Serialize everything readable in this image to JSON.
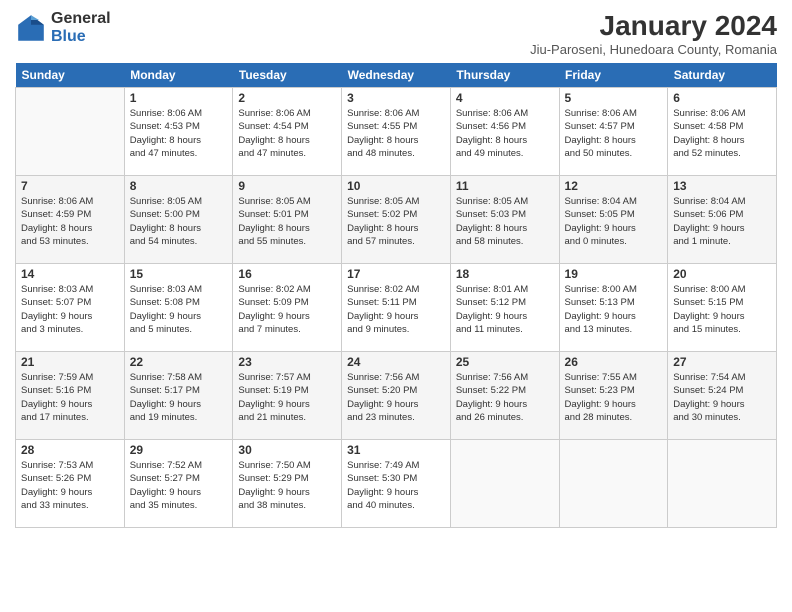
{
  "logo": {
    "general": "General",
    "blue": "Blue"
  },
  "title": "January 2024",
  "subtitle": "Jiu-Paroseni, Hunedoara County, Romania",
  "days_header": [
    "Sunday",
    "Monday",
    "Tuesday",
    "Wednesday",
    "Thursday",
    "Friday",
    "Saturday"
  ],
  "weeks": [
    [
      {
        "num": "",
        "info": ""
      },
      {
        "num": "1",
        "info": "Sunrise: 8:06 AM\nSunset: 4:53 PM\nDaylight: 8 hours\nand 47 minutes."
      },
      {
        "num": "2",
        "info": "Sunrise: 8:06 AM\nSunset: 4:54 PM\nDaylight: 8 hours\nand 47 minutes."
      },
      {
        "num": "3",
        "info": "Sunrise: 8:06 AM\nSunset: 4:55 PM\nDaylight: 8 hours\nand 48 minutes."
      },
      {
        "num": "4",
        "info": "Sunrise: 8:06 AM\nSunset: 4:56 PM\nDaylight: 8 hours\nand 49 minutes."
      },
      {
        "num": "5",
        "info": "Sunrise: 8:06 AM\nSunset: 4:57 PM\nDaylight: 8 hours\nand 50 minutes."
      },
      {
        "num": "6",
        "info": "Sunrise: 8:06 AM\nSunset: 4:58 PM\nDaylight: 8 hours\nand 52 minutes."
      }
    ],
    [
      {
        "num": "7",
        "info": "Sunrise: 8:06 AM\nSunset: 4:59 PM\nDaylight: 8 hours\nand 53 minutes."
      },
      {
        "num": "8",
        "info": "Sunrise: 8:05 AM\nSunset: 5:00 PM\nDaylight: 8 hours\nand 54 minutes."
      },
      {
        "num": "9",
        "info": "Sunrise: 8:05 AM\nSunset: 5:01 PM\nDaylight: 8 hours\nand 55 minutes."
      },
      {
        "num": "10",
        "info": "Sunrise: 8:05 AM\nSunset: 5:02 PM\nDaylight: 8 hours\nand 57 minutes."
      },
      {
        "num": "11",
        "info": "Sunrise: 8:05 AM\nSunset: 5:03 PM\nDaylight: 8 hours\nand 58 minutes."
      },
      {
        "num": "12",
        "info": "Sunrise: 8:04 AM\nSunset: 5:05 PM\nDaylight: 9 hours\nand 0 minutes."
      },
      {
        "num": "13",
        "info": "Sunrise: 8:04 AM\nSunset: 5:06 PM\nDaylight: 9 hours\nand 1 minute."
      }
    ],
    [
      {
        "num": "14",
        "info": "Sunrise: 8:03 AM\nSunset: 5:07 PM\nDaylight: 9 hours\nand 3 minutes."
      },
      {
        "num": "15",
        "info": "Sunrise: 8:03 AM\nSunset: 5:08 PM\nDaylight: 9 hours\nand 5 minutes."
      },
      {
        "num": "16",
        "info": "Sunrise: 8:02 AM\nSunset: 5:09 PM\nDaylight: 9 hours\nand 7 minutes."
      },
      {
        "num": "17",
        "info": "Sunrise: 8:02 AM\nSunset: 5:11 PM\nDaylight: 9 hours\nand 9 minutes."
      },
      {
        "num": "18",
        "info": "Sunrise: 8:01 AM\nSunset: 5:12 PM\nDaylight: 9 hours\nand 11 minutes."
      },
      {
        "num": "19",
        "info": "Sunrise: 8:00 AM\nSunset: 5:13 PM\nDaylight: 9 hours\nand 13 minutes."
      },
      {
        "num": "20",
        "info": "Sunrise: 8:00 AM\nSunset: 5:15 PM\nDaylight: 9 hours\nand 15 minutes."
      }
    ],
    [
      {
        "num": "21",
        "info": "Sunrise: 7:59 AM\nSunset: 5:16 PM\nDaylight: 9 hours\nand 17 minutes."
      },
      {
        "num": "22",
        "info": "Sunrise: 7:58 AM\nSunset: 5:17 PM\nDaylight: 9 hours\nand 19 minutes."
      },
      {
        "num": "23",
        "info": "Sunrise: 7:57 AM\nSunset: 5:19 PM\nDaylight: 9 hours\nand 21 minutes."
      },
      {
        "num": "24",
        "info": "Sunrise: 7:56 AM\nSunset: 5:20 PM\nDaylight: 9 hours\nand 23 minutes."
      },
      {
        "num": "25",
        "info": "Sunrise: 7:56 AM\nSunset: 5:22 PM\nDaylight: 9 hours\nand 26 minutes."
      },
      {
        "num": "26",
        "info": "Sunrise: 7:55 AM\nSunset: 5:23 PM\nDaylight: 9 hours\nand 28 minutes."
      },
      {
        "num": "27",
        "info": "Sunrise: 7:54 AM\nSunset: 5:24 PM\nDaylight: 9 hours\nand 30 minutes."
      }
    ],
    [
      {
        "num": "28",
        "info": "Sunrise: 7:53 AM\nSunset: 5:26 PM\nDaylight: 9 hours\nand 33 minutes."
      },
      {
        "num": "29",
        "info": "Sunrise: 7:52 AM\nSunset: 5:27 PM\nDaylight: 9 hours\nand 35 minutes."
      },
      {
        "num": "30",
        "info": "Sunrise: 7:50 AM\nSunset: 5:29 PM\nDaylight: 9 hours\nand 38 minutes."
      },
      {
        "num": "31",
        "info": "Sunrise: 7:49 AM\nSunset: 5:30 PM\nDaylight: 9 hours\nand 40 minutes."
      },
      {
        "num": "",
        "info": ""
      },
      {
        "num": "",
        "info": ""
      },
      {
        "num": "",
        "info": ""
      }
    ]
  ]
}
